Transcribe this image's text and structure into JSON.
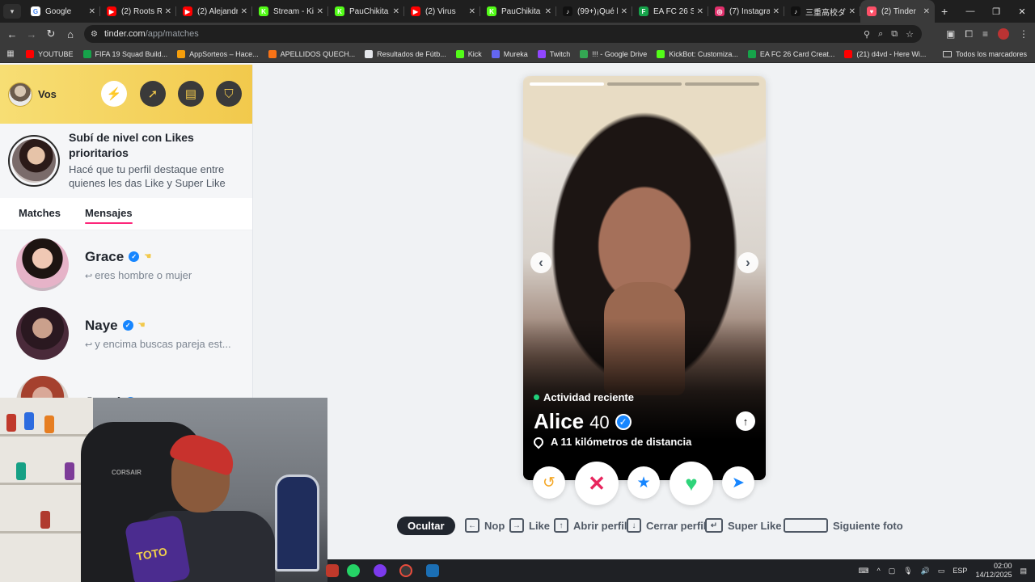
{
  "browser": {
    "tabs": [
      {
        "title": "Google",
        "color": "#ffffff",
        "glyph": "G"
      },
      {
        "title": "(2) Roots Re",
        "color": "#ff0000",
        "glyph": "▶"
      },
      {
        "title": "(2) Alejandra",
        "color": "#ff0000",
        "glyph": "▶"
      },
      {
        "title": "Stream - Kick",
        "color": "#53fc18",
        "glyph": "K"
      },
      {
        "title": "PauChikita S",
        "color": "#53fc18",
        "glyph": "K"
      },
      {
        "title": "(2) Virus",
        "color": "#ff0000",
        "glyph": "▶"
      },
      {
        "title": "PauChikita S",
        "color": "#53fc18",
        "glyph": "K"
      },
      {
        "title": "(99+)¡Qué b",
        "color": "#111111",
        "glyph": "♪"
      },
      {
        "title": "EA FC 26 Sq",
        "color": "#16a34a",
        "glyph": "F"
      },
      {
        "title": "(7) Instagram",
        "color": "#e1306c",
        "glyph": "◎"
      },
      {
        "title": "三重高校ダ",
        "color": "#111111",
        "glyph": "♪"
      },
      {
        "title": "(2) Tinder",
        "color": "#fd5068",
        "glyph": "♥"
      }
    ],
    "url_domain": "tinder.com",
    "url_path": "/app/matches",
    "bookmarks": [
      {
        "label": "YOUTUBE",
        "color": "#ff0000"
      },
      {
        "label": "FIFA 19 Squad Build...",
        "color": "#16a34a"
      },
      {
        "label": "AppSorteos – Hace...",
        "color": "#f59e0b"
      },
      {
        "label": "APELLIDOS QUECH...",
        "color": "#f97316"
      },
      {
        "label": "Resultados de Fútb...",
        "color": "#e5e7eb"
      },
      {
        "label": "Kick",
        "color": "#53fc18"
      },
      {
        "label": "Mureka",
        "color": "#6366f1"
      },
      {
        "label": "Twitch",
        "color": "#9146ff"
      },
      {
        "label": "!!! - Google Drive",
        "color": "#34a853"
      },
      {
        "label": "KickBot: Customiza...",
        "color": "#53fc18"
      },
      {
        "label": "EA FC 26 Card Creat...",
        "color": "#16a34a"
      },
      {
        "label": "(21) d4vd - Here Wi...",
        "color": "#ff0000"
      }
    ],
    "all_bookmarks": "Todos los marcadores"
  },
  "sidebar": {
    "user_label": "Vos",
    "promo_title": "Subí de nivel con Likes prioritarios",
    "promo_subtitle": "Hacé que tu perfil destaque entre quienes les das Like y Super Like",
    "tab_matches": "Matches",
    "tab_messages": "Mensajes",
    "messages": [
      {
        "name": "Grace",
        "preview": "eres hombre o mujer",
        "avatar": "radial-gradient(circle at 50% 38%, #f0c8b4 0 24%, #1d1411 25% 48%, #e6b3c8 49% 70%, #c7b6c0 71%)"
      },
      {
        "name": "Naye",
        "preview": "y encima buscas pareja est...",
        "avatar": "radial-gradient(circle at 50% 40%, #caa08c 0 24%, #2a1820 25% 52%, #4a2a3a 53%)"
      },
      {
        "name": "Juani",
        "preview": "",
        "avatar": "radial-gradient(circle at 50% 40%, #d9a898 0 24%, #a5412e 25% 52%, #d8cfc8 53%)"
      }
    ]
  },
  "profile": {
    "activity": "Actividad reciente",
    "name": "Alice",
    "age": "40",
    "distance": "A 11 kilómetros de distancia",
    "photo_count": 3,
    "current_photo": 1
  },
  "shortcuts": {
    "hide": "Ocultar",
    "nope": "Nop",
    "like": "Like",
    "open_profile": "Abrir perfil",
    "close_profile": "Cerrar perfil",
    "super_like": "Super Like",
    "next_photo": "Siguiente foto"
  },
  "webcam": {
    "chair_brand": "CORSAIR"
  },
  "taskbar": {
    "lang": "ESP",
    "time": "02:00",
    "date": "14/12/2025"
  },
  "colors": {
    "accent": "#fd267a",
    "verified": "#1786ff",
    "online": "#21d07c"
  }
}
